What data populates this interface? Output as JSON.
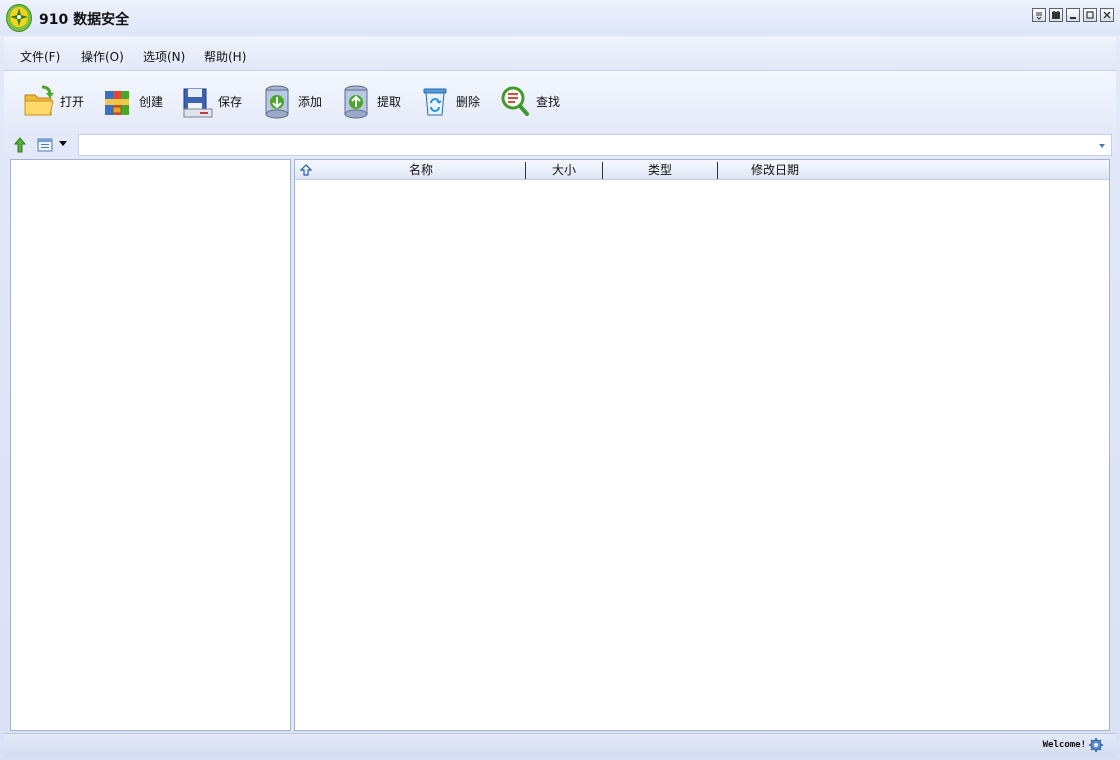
{
  "window": {
    "title": "910 数据安全"
  },
  "menu": [
    "文件(F)",
    "操作(O)",
    "选项(N)",
    "帮助(H)"
  ],
  "toolbar": [
    {
      "label": "打开",
      "icon": "open-folder-icon"
    },
    {
      "label": "创建",
      "icon": "create-archive-icon"
    },
    {
      "label": "保存",
      "icon": "save-icon"
    },
    {
      "label": "添加",
      "icon": "add-icon"
    },
    {
      "label": "提取",
      "icon": "extract-icon"
    },
    {
      "label": "删除",
      "icon": "delete-icon"
    },
    {
      "label": "查找",
      "icon": "search-icon"
    }
  ],
  "address": {
    "value": ""
  },
  "list": {
    "columns": [
      "名称",
      "大小",
      "类型",
      "修改日期"
    ],
    "rows": []
  },
  "status": {
    "text": "Welcome!"
  },
  "colors": {
    "window_bg": "#dde5f7",
    "accent": "#4c7ab8",
    "logo_green": "#7ac143",
    "logo_yellow": "#f4d31a"
  }
}
